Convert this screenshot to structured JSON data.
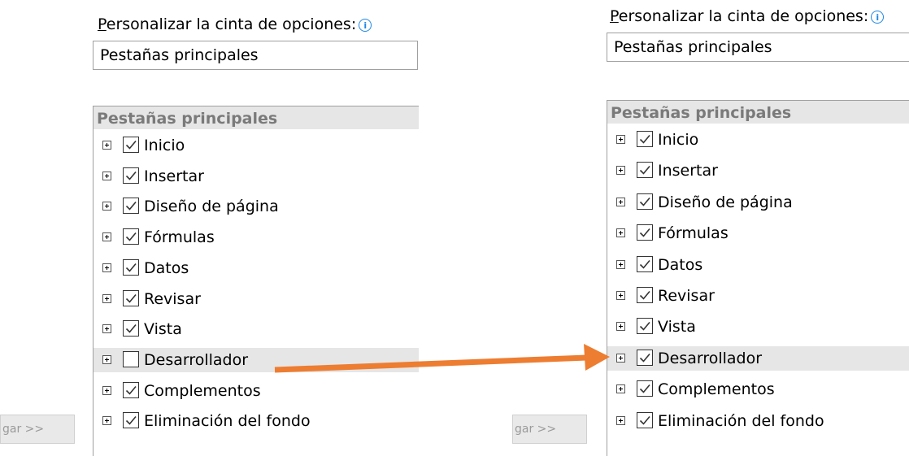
{
  "left_panel": {
    "heading": {
      "accel": "P",
      "rest": "ersonalizar la cinta de opciones:"
    },
    "dropdown_value": "Pestañas principales",
    "tree_header": "Pestañas principales",
    "items": [
      {
        "label": "Inicio",
        "checked": true
      },
      {
        "label": "Insertar",
        "checked": true
      },
      {
        "label": "Diseño de página",
        "checked": true
      },
      {
        "label": "Fórmulas",
        "checked": true
      },
      {
        "label": "Datos",
        "checked": true
      },
      {
        "label": "Revisar",
        "checked": true
      },
      {
        "label": "Vista",
        "checked": true
      },
      {
        "label": "Desarrollador",
        "checked": false,
        "selected": true
      },
      {
        "label": "Complementos",
        "checked": true
      },
      {
        "label": "Eliminación del fondo",
        "checked": true
      }
    ],
    "add_button_label": "gar >>"
  },
  "right_panel": {
    "heading": {
      "accel": "P",
      "rest": "ersonalizar la cinta de opciones:"
    },
    "dropdown_value": "Pestañas principales",
    "tree_header": "Pestañas principales",
    "items": [
      {
        "label": "Inicio",
        "checked": true
      },
      {
        "label": "Insertar",
        "checked": true
      },
      {
        "label": "Diseño de página",
        "checked": true
      },
      {
        "label": "Fórmulas",
        "checked": true
      },
      {
        "label": "Datos",
        "checked": true
      },
      {
        "label": "Revisar",
        "checked": true
      },
      {
        "label": "Vista",
        "checked": true
      },
      {
        "label": "Desarrollador",
        "checked": true,
        "selected": true
      },
      {
        "label": "Complementos",
        "checked": true
      },
      {
        "label": "Eliminación del fondo",
        "checked": true
      }
    ],
    "add_button_label": "gar >>"
  },
  "colors": {
    "arrow": "#ed7d31",
    "info_icon": "#1e88e5",
    "selection": "#e6e6e6"
  },
  "icons": {
    "info": "info-icon",
    "expand": "plus-box-icon",
    "check": "checkmark-icon",
    "arrow": "arrow-right-icon"
  }
}
